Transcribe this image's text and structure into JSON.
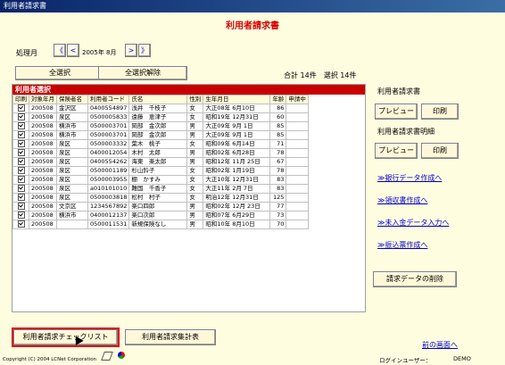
{
  "window": {
    "title": "利用者請求書"
  },
  "header": {
    "title": "利用者請求書"
  },
  "period": {
    "label": "処理月",
    "value": "2005年 8月",
    "first": "《",
    "prev": "<",
    "next": ">",
    "last": "》"
  },
  "actions": {
    "select_all": "全選択",
    "deselect_all": "全選択解除"
  },
  "totals": {
    "text": "合計 14件　選択 14件"
  },
  "list": {
    "title": "利用者選択",
    "columns": [
      "印刷",
      "対象年月",
      "保険者名",
      "利用者コード",
      "氏名",
      "性別",
      "生年月日",
      "年齢",
      "申請中"
    ],
    "rows": [
      {
        "ym": "200508",
        "ins": "金沢区",
        "code": "0400554897",
        "name": "浅井　千枝子",
        "sex": "女",
        "dob": "大正08年 6月10日",
        "age": "86",
        "app": ""
      },
      {
        "ym": "200508",
        "ins": "泉区",
        "code": "0500005833",
        "name": "遠藤　恵津子",
        "sex": "女",
        "dob": "昭和19年 12月31日",
        "age": "60",
        "app": ""
      },
      {
        "ym": "200508",
        "ins": "横浜市",
        "code": "0500003701",
        "name": "岡部　金次郎",
        "sex": "男",
        "dob": "大正09年 9月 1日",
        "age": "85",
        "app": ""
      },
      {
        "ym": "200508",
        "ins": "横浜市",
        "code": "0500003701",
        "name": "岡部　金次郎",
        "sex": "男",
        "dob": "大正09年 9月 1日",
        "age": "85",
        "app": ""
      },
      {
        "ym": "200508",
        "ins": "泉区",
        "code": "0500003332",
        "name": "葉木　桃子",
        "sex": "女",
        "dob": "昭和09年 6月14日",
        "age": "71",
        "app": ""
      },
      {
        "ym": "200508",
        "ins": "泉区",
        "code": "0400012054",
        "name": "木村　太郎",
        "sex": "男",
        "dob": "昭和02年 6月28日",
        "age": "78",
        "app": ""
      },
      {
        "ym": "200508",
        "ins": "泉区",
        "code": "0400554262",
        "name": "海東　楽太郎",
        "sex": "男",
        "dob": "昭和12年 11月 25日",
        "age": "67",
        "app": ""
      },
      {
        "ym": "200508",
        "ins": "泉区",
        "code": "0500001189",
        "name": "杉山鈴子",
        "sex": "女",
        "dob": "昭和02年 1月19日",
        "age": "78",
        "app": ""
      },
      {
        "ym": "200508",
        "ins": "泉区",
        "code": "0500003955",
        "name": "棚　かすみ",
        "sex": "女",
        "dob": "大正10年 12月31日",
        "age": "83",
        "app": ""
      },
      {
        "ym": "200508",
        "ins": "泉区",
        "code": "a010101010",
        "name": "難国　千香子",
        "sex": "女",
        "dob": "大正11年 2月 7日",
        "age": "83",
        "app": ""
      },
      {
        "ym": "200508",
        "ins": "泉区",
        "code": "0500003818",
        "name": "松村　村子",
        "sex": "女",
        "dob": "明治12年 12月31日",
        "age": "125",
        "app": ""
      },
      {
        "ym": "200508",
        "ins": "文京区",
        "code": "1234567892",
        "name": "楽口四郎",
        "sex": "男",
        "dob": "昭和02年 12月 23日",
        "age": "77",
        "app": ""
      },
      {
        "ym": "200508",
        "ins": "横浜市",
        "code": "0400012137",
        "name": "楽口次郎",
        "sex": "男",
        "dob": "昭和07年 6月29日",
        "age": "73",
        "app": ""
      },
      {
        "ym": "200508",
        "ins": "",
        "code": "0500011531",
        "name": "新規保険なし",
        "sex": "男",
        "dob": "昭和10年 8月10日",
        "age": "70",
        "app": ""
      }
    ]
  },
  "right": {
    "invoice_label": "利用者請求書",
    "detail_label": "利用者請求書明細",
    "preview": "プレビュー",
    "print": "印刷",
    "links": [
      "≫銀行データ作成へ",
      "≫領収書作成へ",
      "≫未入金データ入力へ",
      "≫振込票作成へ"
    ],
    "delete": "請求データの削除",
    "back": "前の画面へ"
  },
  "bottom": {
    "checklist": "利用者請求チェックリスト",
    "summary": "利用者請求集計表"
  },
  "footer": {
    "copyright": "Copyright (C) 2004 LCNet Corporation",
    "login_label": "ログインユーザー：",
    "login_user": "DEMO"
  },
  "colors": {
    "background": "#fffde0",
    "heading": "#d80000",
    "panel_header": "#c80000",
    "link": "#0000cc"
  }
}
